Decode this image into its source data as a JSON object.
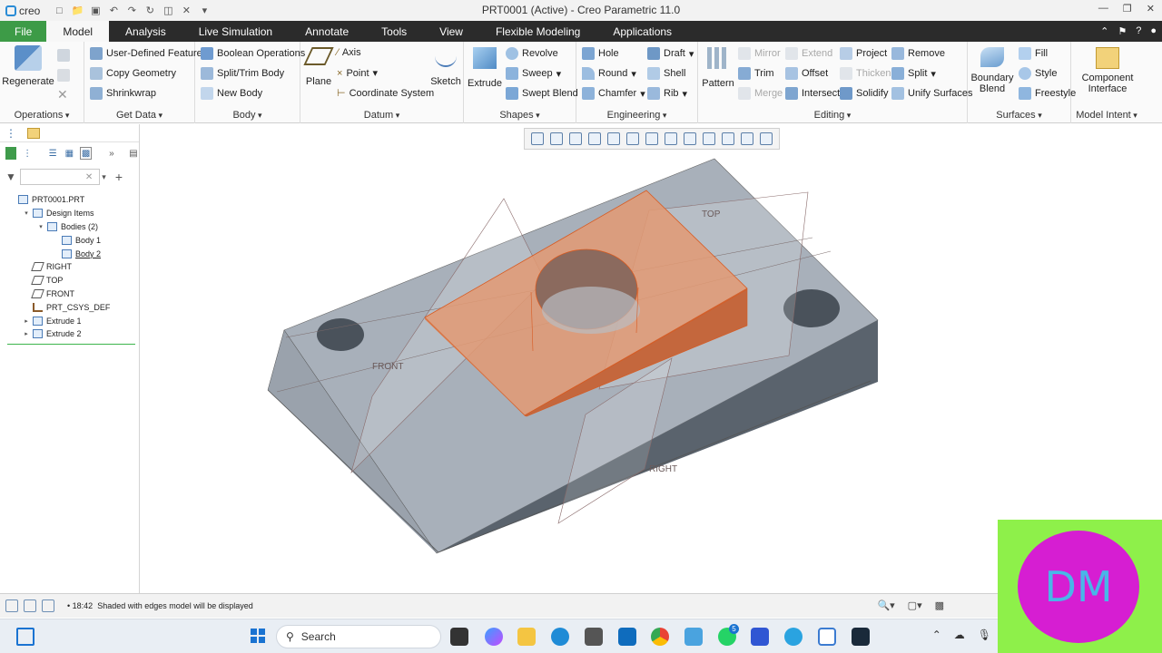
{
  "app": {
    "logo": "creo",
    "window_title": "PRT0001 (Active) - Creo Parametric 11.0"
  },
  "tabs": [
    "File",
    "Model",
    "Analysis",
    "Live Simulation",
    "Annotate",
    "Tools",
    "View",
    "Flexible Modeling",
    "Applications"
  ],
  "ribbon": {
    "operations": {
      "label": "Operations",
      "regenerate": "Regenerate"
    },
    "get_data": {
      "label": "Get Data",
      "items": [
        "User-Defined Feature",
        "Copy Geometry",
        "Shrinkwrap"
      ]
    },
    "body": {
      "label": "Body",
      "items": [
        "Boolean Operations",
        "Split/Trim Body",
        "New Body"
      ]
    },
    "datum": {
      "label": "Datum",
      "plane": "Plane",
      "axis": "Axis",
      "point": "Point",
      "csys": "Coordinate System",
      "sketch": "Sketch"
    },
    "shapes": {
      "label": "Shapes",
      "extrude": "Extrude",
      "revolve": "Revolve",
      "sweep": "Sweep",
      "swept_blend": "Swept Blend"
    },
    "engineering": {
      "label": "Engineering",
      "hole": "Hole",
      "round": "Round",
      "chamfer": "Chamfer",
      "draft": "Draft",
      "shell": "Shell",
      "rib": "Rib"
    },
    "editing": {
      "label": "Editing",
      "pattern": "Pattern",
      "mirror": "Mirror",
      "trim": "Trim",
      "merge": "Merge",
      "extend": "Extend",
      "offset": "Offset",
      "intersect": "Intersect",
      "project": "Project",
      "thicken": "Thicken",
      "solidify": "Solidify",
      "remove": "Remove",
      "split": "Split",
      "unify": "Unify Surfaces"
    },
    "surfaces": {
      "label": "Surfaces",
      "boundary_1": "Boundary",
      "boundary_2": "Blend",
      "fill": "Fill",
      "style": "Style",
      "freestyle": "Freestyle"
    },
    "model_intent": {
      "label": "Model Intent",
      "component_1": "Component",
      "component_2": "Interface"
    }
  },
  "tree": [
    {
      "label": "PRT0001.PRT",
      "level": 0,
      "icon": "part"
    },
    {
      "label": "Design Items",
      "level": 1,
      "icon": "folder",
      "expanded": true
    },
    {
      "label": "Bodies (2)",
      "level": 2,
      "icon": "bodies",
      "expanded": true
    },
    {
      "label": "Body 1",
      "level": 3,
      "icon": "body"
    },
    {
      "label": "Body 2",
      "level": 3,
      "icon": "body",
      "hover": true
    },
    {
      "label": "RIGHT",
      "level": 1,
      "icon": "plane"
    },
    {
      "label": "TOP",
      "level": 1,
      "icon": "plane"
    },
    {
      "label": "FRONT",
      "level": 1,
      "icon": "plane"
    },
    {
      "label": "PRT_CSYS_DEF",
      "level": 1,
      "icon": "csys"
    },
    {
      "label": "Extrude 1",
      "level": 1,
      "icon": "feature",
      "collapsed": true
    },
    {
      "label": "Extrude 2",
      "level": 1,
      "icon": "feature",
      "collapsed": true
    }
  ],
  "viewport": {
    "plane_labels": {
      "top": "TOP",
      "front": "FRONT",
      "right": "RIGHT"
    }
  },
  "status": {
    "time": "18:42",
    "message": "Shaded with edges model will be displayed"
  },
  "taskbar": {
    "search": "Search",
    "badge": "5"
  },
  "overlay": {
    "text": "DM"
  },
  "colors": {
    "file_tab": "#3d9b47",
    "body_orange": "#e07a4a",
    "base_block": "#9aa3ae",
    "dm_bg": "#8ef04a",
    "dm_circle": "#d61ed2"
  }
}
